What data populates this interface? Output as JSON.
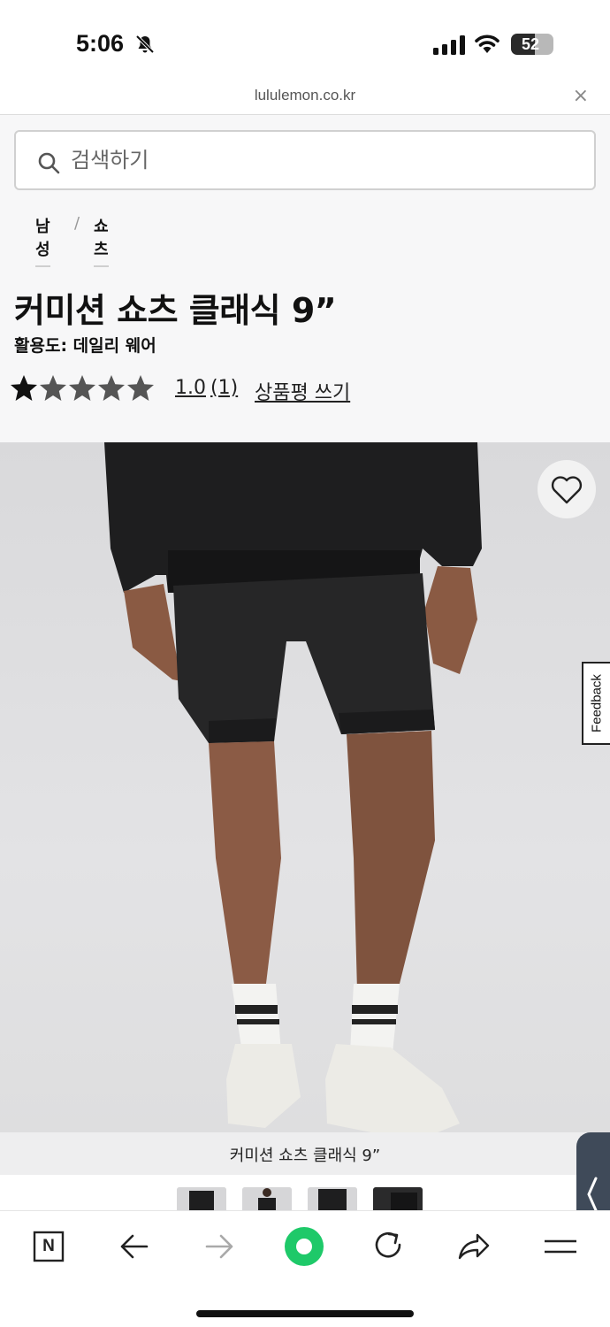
{
  "status_bar": {
    "time": "5:06",
    "battery": "52",
    "battery_level": 0.52
  },
  "browser": {
    "url": "lululemon.co.kr",
    "close_label": "×"
  },
  "search": {
    "placeholder": "검색하기"
  },
  "breadcrumb": {
    "items": [
      "남성",
      "쇼츠"
    ],
    "separator": "/"
  },
  "product": {
    "title": "커미션 쇼츠 클래식 9”",
    "activity": "활용도: 데일리 웨어",
    "rating": {
      "stars_filled": 1,
      "stars_total": 5,
      "value": "1.0",
      "count": "(1)",
      "write_review_label": "상품평 쓰기"
    },
    "image_caption": "커미션 쇼츠 클래식 9”"
  },
  "feedback": {
    "label": "Feedback"
  },
  "colors": {
    "accent_green": "#1ec969",
    "side_panel": "#3f4a59",
    "page_bg": "#f7f7f8"
  },
  "toolbar": {
    "icons": [
      "naver-n-icon",
      "back-arrow-icon",
      "forward-arrow-icon",
      "green-dot-icon",
      "reload-icon",
      "share-icon",
      "menu-icon"
    ],
    "naver_label": "N"
  }
}
